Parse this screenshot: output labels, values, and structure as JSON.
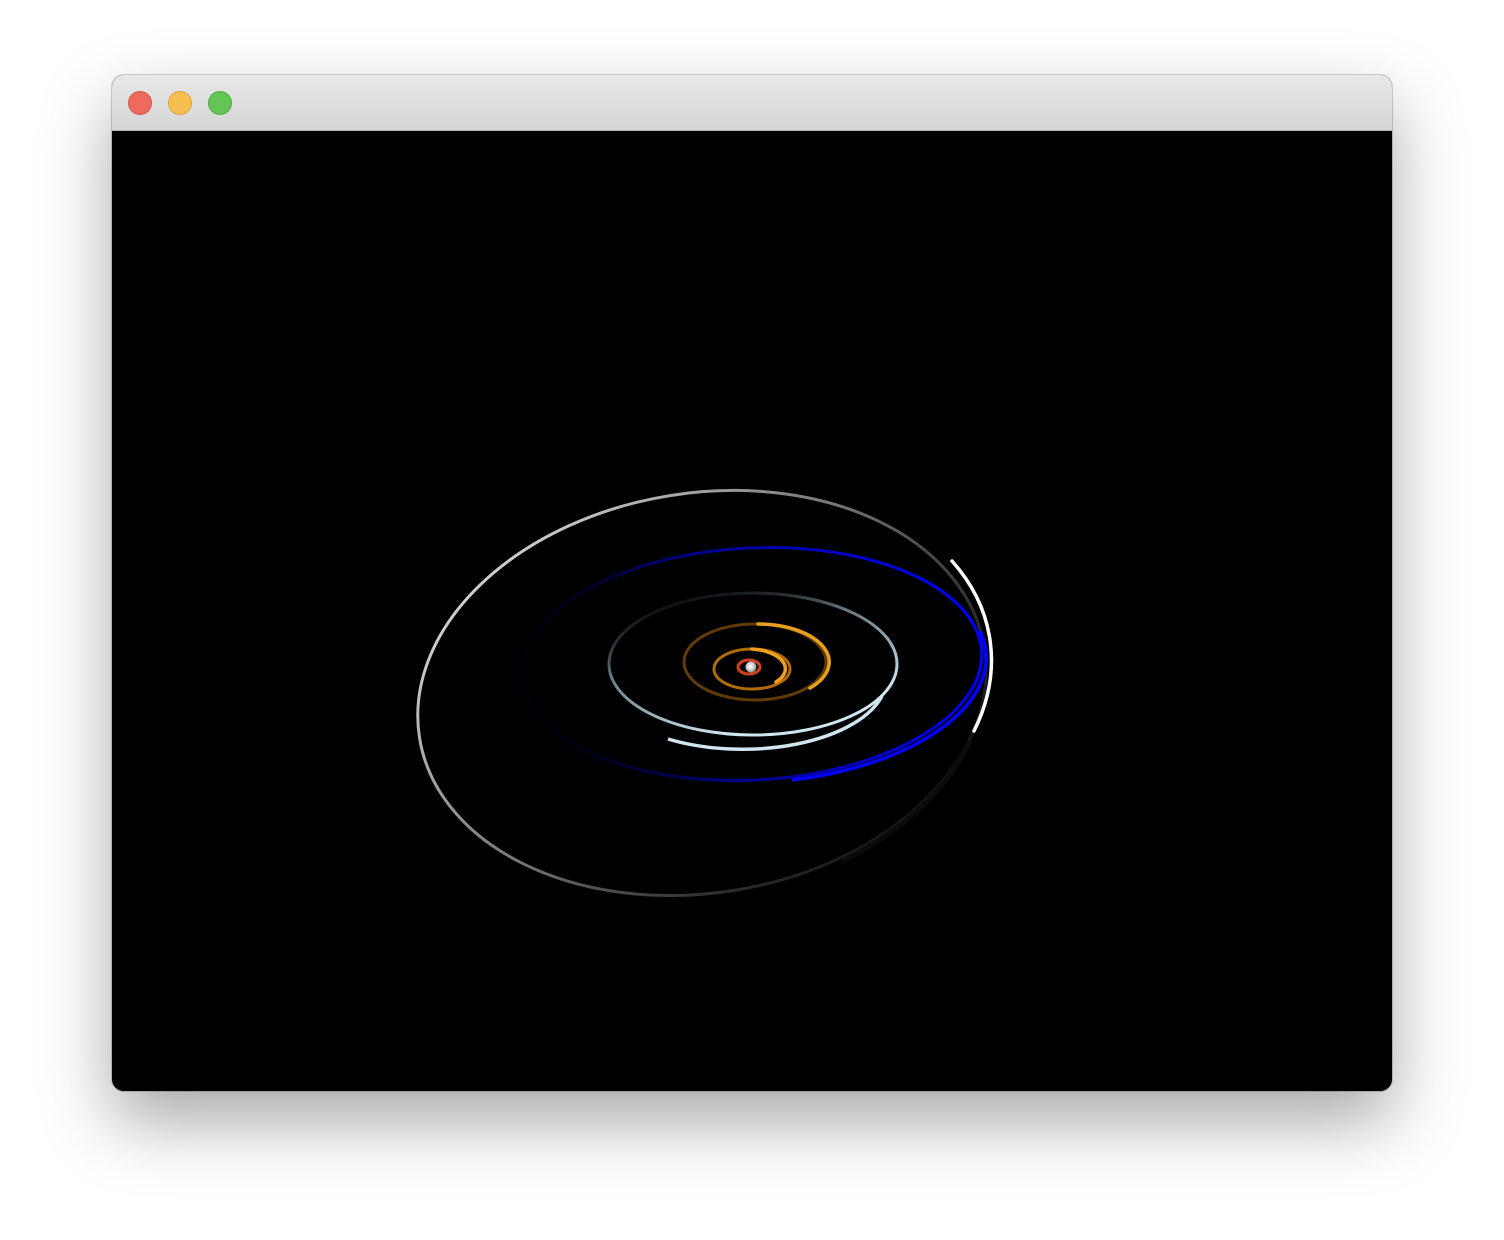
{
  "window": {
    "controls": {
      "close_color": "#ed6a5e",
      "minimize_color": "#f5bf4f",
      "zoom_color": "#62c554"
    }
  },
  "scene": {
    "background": "#000000",
    "orbits": [
      {
        "name": "orbit-1",
        "color": "#d04020"
      },
      {
        "name": "orbit-2",
        "color": "#e08a10"
      },
      {
        "name": "orbit-3",
        "color": "#e8a020"
      },
      {
        "name": "orbit-4",
        "color": "#b8d4e0"
      },
      {
        "name": "orbit-5",
        "color": "#0000ff"
      },
      {
        "name": "orbit-6",
        "color": "#e8e8e8"
      }
    ],
    "sun_color": "#dddddd"
  }
}
